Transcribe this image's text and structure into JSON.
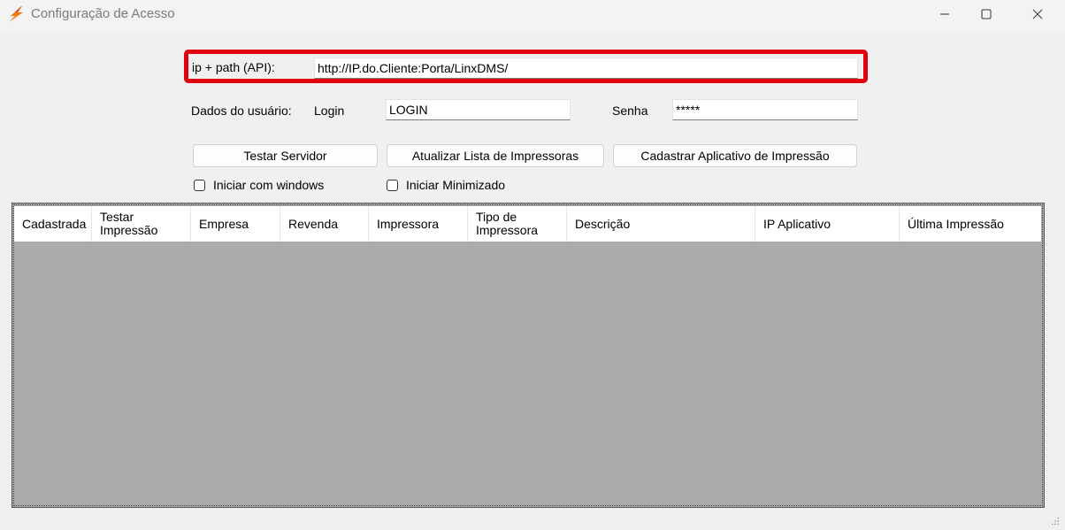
{
  "window": {
    "title": "Configuração de Acesso",
    "logo_icon": "orange-lightning-icon",
    "controls": [
      "minimize-icon",
      "maximize-icon",
      "close-icon"
    ]
  },
  "api": {
    "label": "ip + path (API):",
    "value": "http://IP.do.Cliente:Porta/LinxDMS/",
    "highlight_color": "#e0000f"
  },
  "user": {
    "section_label": "Dados do usuário:",
    "login_label": "Login",
    "login_value": "LOGIN",
    "password_label": "Senha",
    "password_value": "*****"
  },
  "buttons": {
    "test_server": "Testar Servidor",
    "update_printers": "Atualizar Lista de Impressoras",
    "register_app": "Cadastrar Aplicativo de Impressão"
  },
  "options": {
    "start_with_windows": {
      "label": "Iniciar com windows",
      "checked": false
    },
    "start_minimized": {
      "label": "Iniciar Minimizado",
      "checked": false
    }
  },
  "grid": {
    "columns": [
      "Cadastrada",
      "Testar\nImpressão",
      "Empresa",
      "Revenda",
      "Impressora",
      "Tipo de\nImpressora",
      "Descrição",
      "IP Aplicativo",
      "Última Impressão"
    ],
    "rows": [],
    "background_color": "#ababab"
  }
}
